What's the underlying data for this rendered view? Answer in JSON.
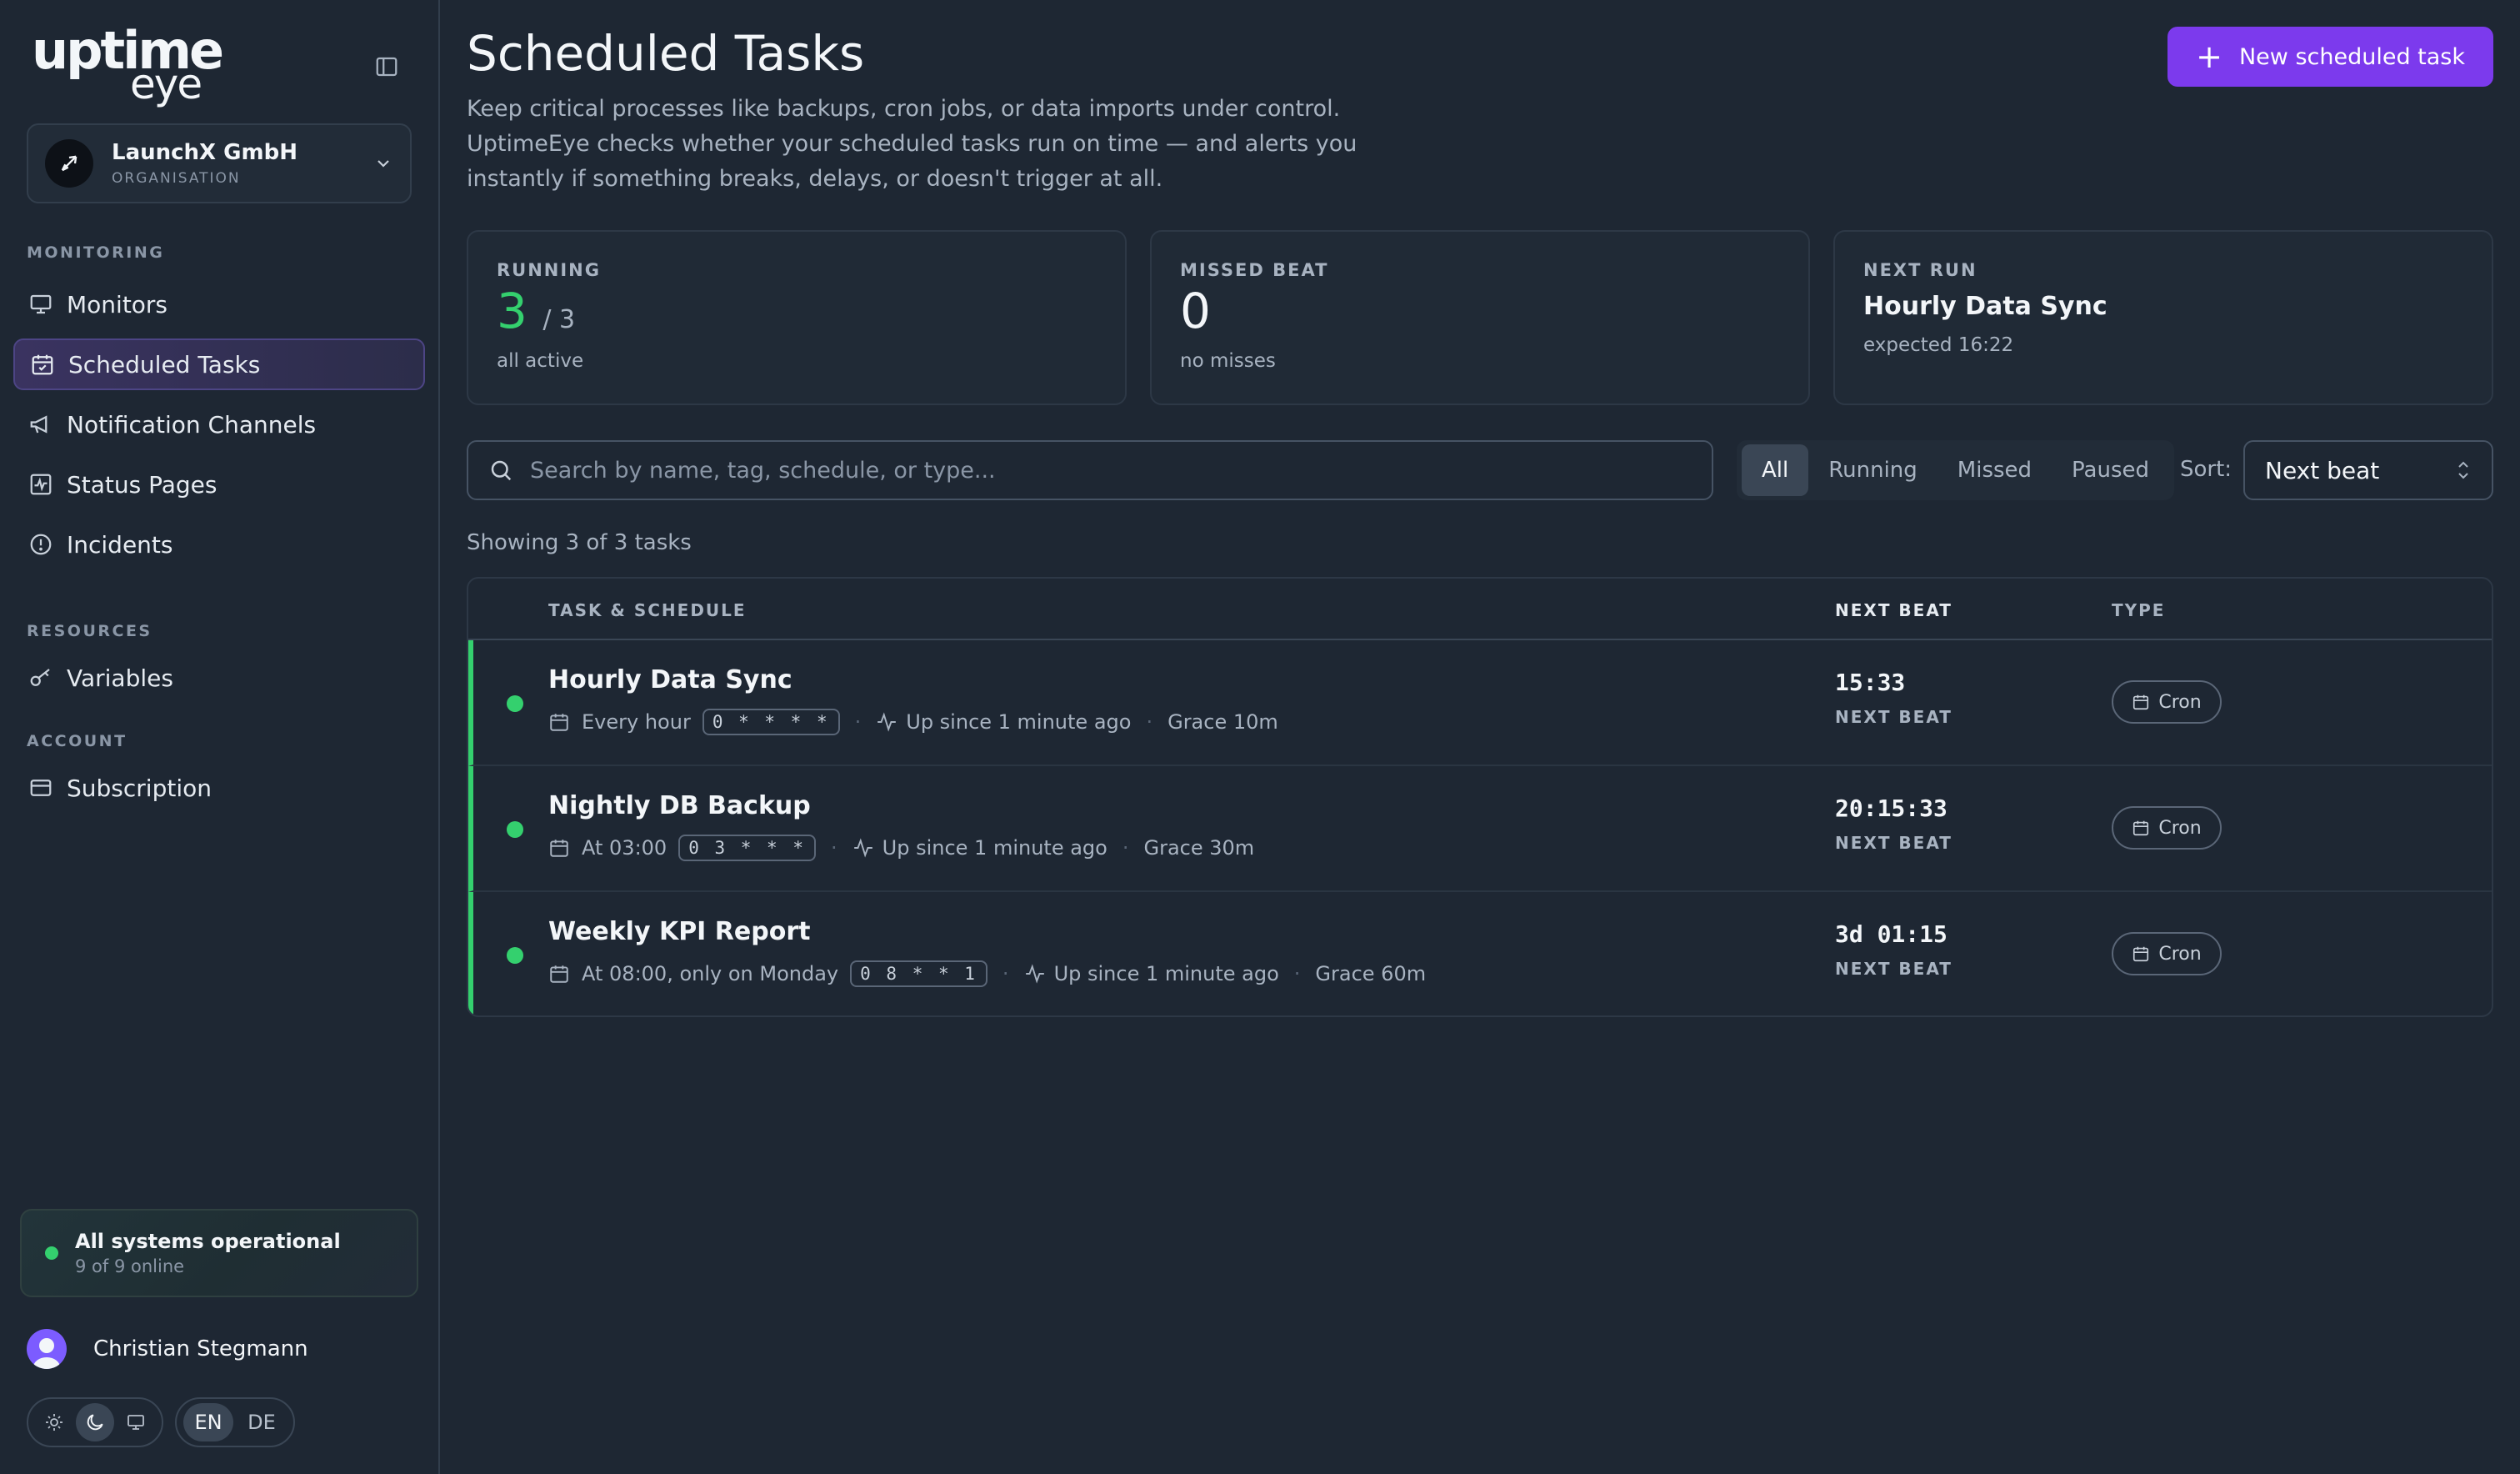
{
  "brand": {
    "logo_top": "uptime",
    "logo_bottom": "eye"
  },
  "org": {
    "name": "LaunchX GmbH",
    "role": "ORGANISATION"
  },
  "sidebar": {
    "sections": [
      {
        "label": "MONITORING"
      },
      {
        "label": "RESOURCES"
      },
      {
        "label": "ACCOUNT"
      }
    ],
    "items": [
      {
        "label": "Monitors",
        "icon": "monitor-icon"
      },
      {
        "label": "Scheduled Tasks",
        "icon": "calendar-check-icon",
        "active": true
      },
      {
        "label": "Notification Channels",
        "icon": "megaphone-icon"
      },
      {
        "label": "Status Pages",
        "icon": "activity-square-icon"
      },
      {
        "label": "Incidents",
        "icon": "alert-circle-icon"
      },
      {
        "label": "Variables",
        "icon": "key-icon"
      },
      {
        "label": "Subscription",
        "icon": "credit-card-icon"
      }
    ]
  },
  "system_status": {
    "title": "All systems operational",
    "sub": "9 of 9 online",
    "color": "#34d06e"
  },
  "user": {
    "name": "Christian Stegmann"
  },
  "theme": {
    "options": [
      "sun-icon",
      "moon-icon",
      "monitor-icon"
    ],
    "selected": "moon-icon"
  },
  "lang": {
    "options": [
      "EN",
      "DE"
    ],
    "selected": "EN"
  },
  "page": {
    "title": "Scheduled Tasks",
    "description": "Keep critical processes like backups, cron jobs, or data imports under control. UptimeEye checks whether your scheduled tasks run on time — and alerts you instantly if something breaks, delays, or doesn't trigger at all.",
    "new_button": "New scheduled task",
    "accent": "#7c3aed"
  },
  "stats": {
    "running": {
      "label": "RUNNING",
      "value": "3",
      "total": "/ 3",
      "sub": "all active"
    },
    "missed": {
      "label": "MISSED BEAT",
      "value": "0",
      "sub": "no misses"
    },
    "next": {
      "label": "NEXT RUN",
      "name": "Hourly Data Sync",
      "expected": "expected 16:22"
    }
  },
  "search": {
    "placeholder": "Search by name, tag, schedule, or type..."
  },
  "filters": {
    "options": [
      "All",
      "Running",
      "Missed",
      "Paused"
    ],
    "selected": "All"
  },
  "sort": {
    "label": "Sort:",
    "value": "Next beat"
  },
  "showing": "Showing 3 of 3 tasks",
  "table": {
    "headers": {
      "task": "TASK & SCHEDULE",
      "next": "NEXT BEAT",
      "type": "TYPE"
    },
    "rows": [
      {
        "name": "Hourly Data Sync",
        "schedule": "Every hour",
        "cron": "0 * * * *",
        "uptime": "Up since 1 minute ago",
        "grace": "Grace 10m",
        "next": "15:33",
        "next_label": "NEXT BEAT",
        "type": "Cron",
        "status": "running"
      },
      {
        "name": "Nightly DB Backup",
        "schedule": "At 03:00",
        "cron": "0 3 * * *",
        "uptime": "Up since 1 minute ago",
        "grace": "Grace 30m",
        "next": "20:15:33",
        "next_label": "NEXT BEAT",
        "type": "Cron",
        "status": "running"
      },
      {
        "name": "Weekly KPI Report",
        "schedule": "At 08:00, only on Monday",
        "cron": "0 8 * * 1",
        "uptime": "Up since 1 minute ago",
        "grace": "Grace 60m",
        "next": "3d 01:15",
        "next_label": "NEXT BEAT",
        "type": "Cron",
        "status": "running"
      }
    ]
  }
}
